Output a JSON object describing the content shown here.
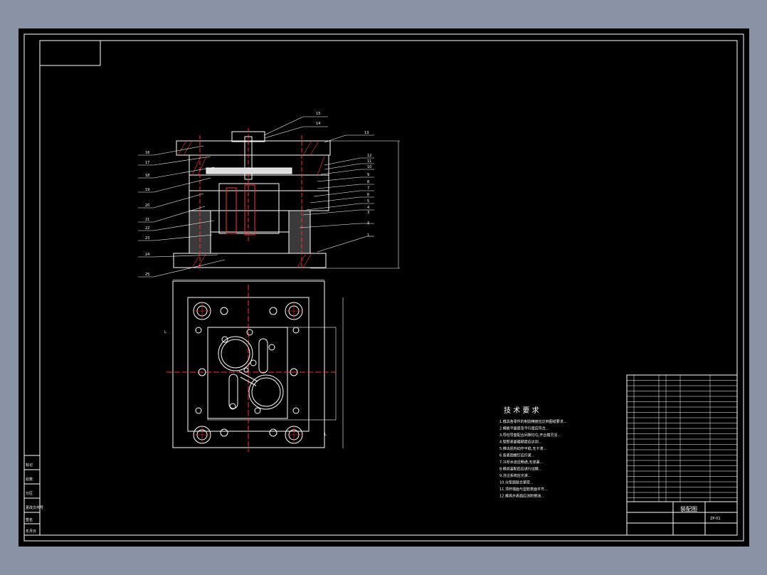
{
  "drawing": {
    "tech_title": "技 术 要 求",
    "tech_lines": [
      "1.模具各零件的制造精度应达到图纸要求...",
      "2.模板平面度及平行度应符合...",
      "3.导柱导套配合间隙均匀,开合模灵活...",
      "4.型腔表面粗糙度应达到...",
      "5.推出机构动作平稳,无卡滞...",
      "6.各紧固螺钉应拧紧...",
      "7.冷却水道应畅通,无渗漏...",
      "8.模具装配后应进行试模...",
      "9.浇注系统应光滑...",
      "10.分型面贴合紧密...",
      "11.顶杆端面与型腔表面平齐...",
      "12.模具外表面应涂防锈油..."
    ],
    "callouts_left": [
      "16",
      "17",
      "18",
      "19",
      "20",
      "21",
      "22",
      "23",
      "24",
      "25"
    ],
    "callouts_right": [
      "15",
      "14",
      "13",
      "12",
      "11",
      "10",
      "9",
      "8",
      "7",
      "6",
      "5",
      "4",
      "3",
      "2",
      "1"
    ],
    "title_block": {
      "name": "装配图",
      "drawing_no": "ZP-01"
    },
    "left_strip_labels": [
      "标记",
      "处数",
      "分区",
      "更改文件号",
      "签名",
      "年月日"
    ]
  }
}
